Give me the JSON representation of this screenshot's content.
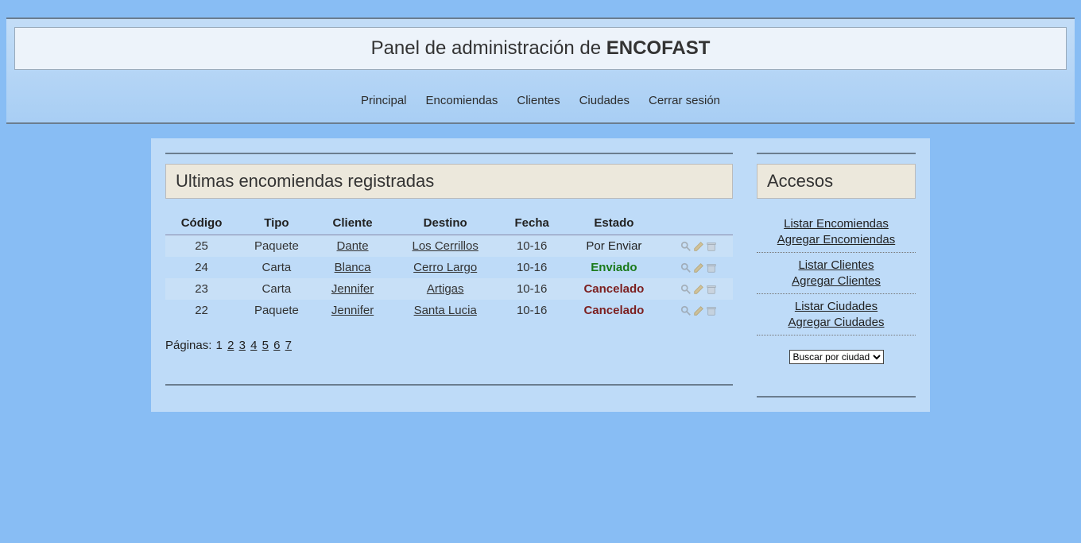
{
  "title": {
    "prefix": "Panel de administración de ",
    "brand": "ENCOFAST"
  },
  "nav": [
    "Principal",
    "Encomiendas",
    "Clientes",
    "Ciudades",
    "Cerrar sesión"
  ],
  "main": {
    "heading": "Ultimas encomiendas registradas",
    "columns": [
      "Código",
      "Tipo",
      "Cliente",
      "Destino",
      "Fecha",
      "Estado"
    ],
    "rows": [
      {
        "codigo": "25",
        "tipo": "Paquete",
        "cliente": "Dante",
        "destino": "Los Cerrillos",
        "fecha": "10-16",
        "estado": "Por Enviar",
        "estado_class": "status-por-enviar"
      },
      {
        "codigo": "24",
        "tipo": "Carta",
        "cliente": "Blanca",
        "destino": "Cerro Largo",
        "fecha": "10-16",
        "estado": "Enviado",
        "estado_class": "status-enviado"
      },
      {
        "codigo": "23",
        "tipo": "Carta",
        "cliente": "Jennifer",
        "destino": "Artigas",
        "fecha": "10-16",
        "estado": "Cancelado",
        "estado_class": "status-cancelado"
      },
      {
        "codigo": "22",
        "tipo": "Paquete",
        "cliente": "Jennifer",
        "destino": "Santa Lucia",
        "fecha": "10-16",
        "estado": "Cancelado",
        "estado_class": "status-cancelado"
      }
    ],
    "pagination_label": "Páginas:",
    "pages": [
      "1",
      "2",
      "3",
      "4",
      "5",
      "6",
      "7"
    ],
    "current_page": "1"
  },
  "sidebar": {
    "heading": "Accesos",
    "groups": [
      [
        "Listar Encomiendas",
        "Agregar Encomiendas"
      ],
      [
        "Listar Clientes",
        "Agregar Clientes"
      ],
      [
        "Listar Ciudades",
        "Agregar Ciudades"
      ]
    ],
    "select_label": "Buscar por ciudad"
  },
  "icons": {
    "search": "search-icon",
    "edit": "edit-icon",
    "delete": "delete-icon"
  }
}
